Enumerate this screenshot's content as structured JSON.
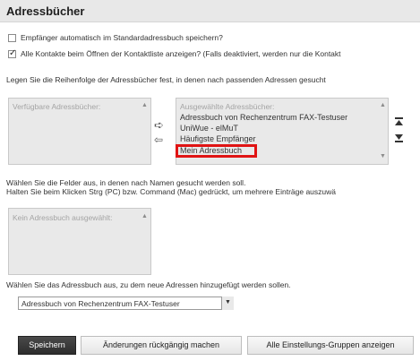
{
  "title": "Adressbücher",
  "checkbox_save_recipients": {
    "label": "Empfänger automatisch im Standardadressbuch speichern?",
    "checked": false
  },
  "checkbox_show_all": {
    "label": "Alle Kontakte beim Öffnen der Kontaktliste anzeigen? (Falls deaktiviert, werden nur die Kontakt",
    "checked": true
  },
  "order_instruction": "Legen Sie die Reihenfolge der Adressbücher fest, in denen nach passenden Adressen gesucht",
  "available_list": {
    "header": "Verfügbare Adressbücher:"
  },
  "selected_list": {
    "header": "Ausgewählte Adressbücher:",
    "items": [
      "Adressbuch von Rechenzentrum FAX-Testuser",
      "UniWue - elMuT",
      "Häufigste Empfänger",
      "Mein Adressbuch"
    ],
    "highlighted_item": "Mein Adressbuch"
  },
  "fields_instruction_1": "Wählen Sie die Felder aus, in denen nach Namen gesucht werden soll.",
  "fields_instruction_2": "Halten Sie beim Klicken Strg (PC) bzw. Command (Mac) gedrückt, um mehrere Einträge auszuwä",
  "fields_list": {
    "header": "Kein Adressbuch ausgewählt:"
  },
  "target_instruction": "Wählen Sie das Adressbuch aus, zu dem neue Adressen hinzugefügt werden sollen.",
  "target_select": {
    "value": "Adressbuch von Rechenzentrum FAX-Testuser"
  },
  "buttons": {
    "save": "Speichern",
    "undo": "Änderungen rückgängig machen",
    "show_all_groups": "Alle Einstellungs-Gruppen anzeigen"
  },
  "icons": {
    "move_right": "arrow-right-icon",
    "move_left": "arrow-left-icon",
    "move_top": "move-to-top-icon",
    "move_bottom": "move-to-bottom-icon",
    "scroll_up": "scroll-up-icon",
    "scroll_down": "scroll-down-icon"
  },
  "colors": {
    "highlight": "#e01414",
    "header_bg": "#e8e8e8",
    "save_button_bg": "#333333"
  }
}
